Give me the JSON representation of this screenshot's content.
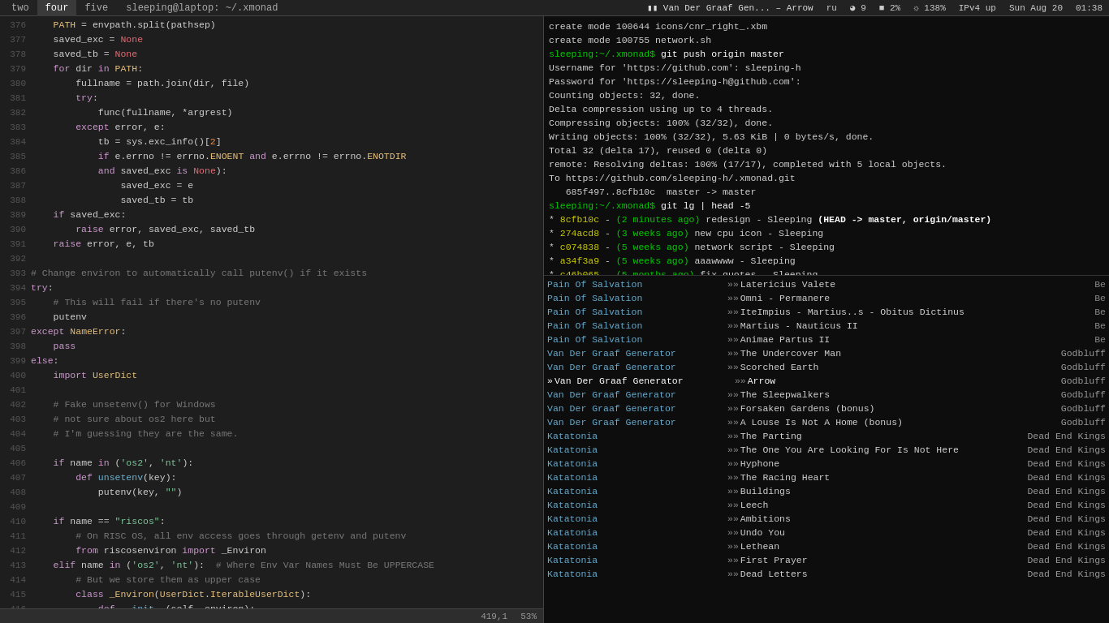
{
  "topbar": {
    "tabs": [
      {
        "label": "two",
        "active": false
      },
      {
        "label": "four",
        "active": true
      },
      {
        "label": "five",
        "active": false
      }
    ],
    "path": "sleeping@laptop: ~/.xmonad",
    "music_title": "Van Der Graaf Gen... – Arrow",
    "lang": "ru",
    "signal": "9",
    "battery": "2%",
    "brightness": "138%",
    "network": "IPv4 up",
    "date": "Sun Aug 20",
    "time": "01:38"
  },
  "editor": {
    "status": "419,1",
    "percent": "53%"
  },
  "terminal": {
    "lines": []
  }
}
